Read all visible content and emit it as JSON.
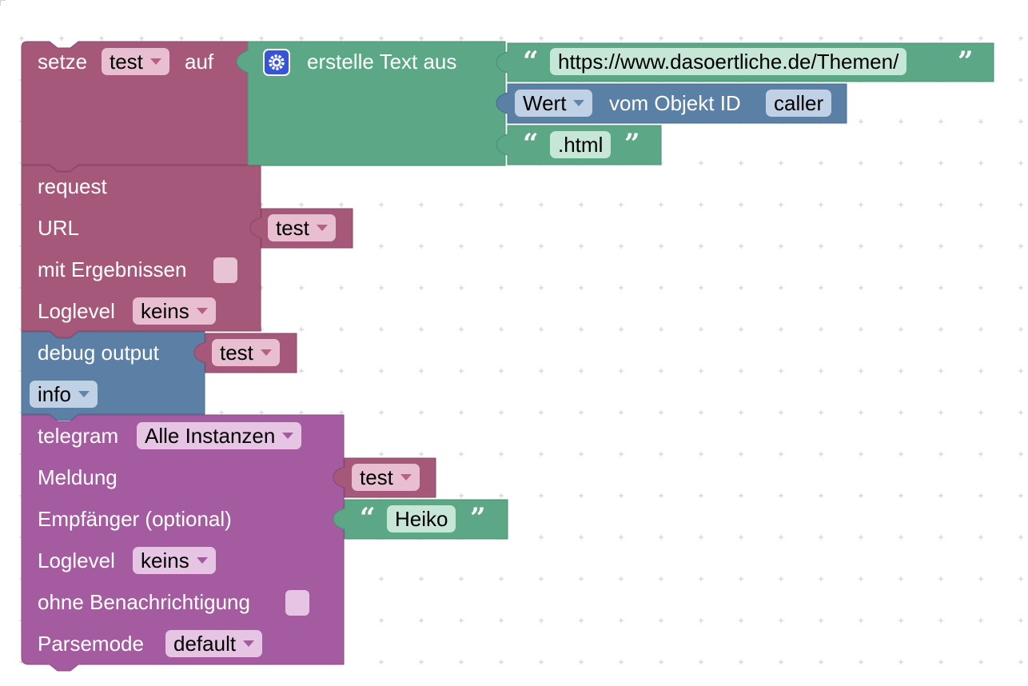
{
  "set_block": {
    "label_set": "setze",
    "variable": "test",
    "label_to": "auf"
  },
  "text_join": {
    "label": "erstelle Text aus",
    "gear_icon": "gear-icon",
    "items": {
      "string1": "https://www.dasoertliche.de/Themen/",
      "state": {
        "attribute": "Wert",
        "label": "vom Objekt ID",
        "id": "caller"
      },
      "string2": ".html"
    }
  },
  "request_block": {
    "title": "request",
    "url_label": "URL",
    "url_var": "test",
    "results_label": "mit Ergebnissen",
    "results_checked": false,
    "loglevel_label": "Loglevel",
    "loglevel_value": "keins"
  },
  "debug_block": {
    "label": "debug output",
    "value_var": "test",
    "level": "info"
  },
  "telegram_block": {
    "label": "telegram",
    "instance": "Alle Instanzen",
    "message_label": "Meldung",
    "message_var": "test",
    "recipient_label": "Empfänger (optional)",
    "recipient_value": "Heiko",
    "loglevel_label": "Loglevel",
    "loglevel_value": "keins",
    "silent_label": "ohne Benachrichtigung",
    "silent_checked": false,
    "parsemode_label": "Parsemode",
    "parsemode_value": "default"
  },
  "colors": {
    "variables": "#a5587a",
    "text": "#5ba786",
    "state": "#5b80a5",
    "debug": "#5b7fa5",
    "telegram": "#a55b9f"
  }
}
